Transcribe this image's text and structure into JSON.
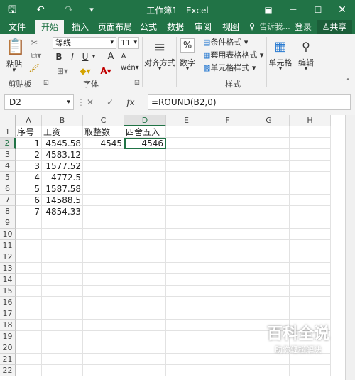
{
  "titlebar": {
    "title": "工作簿1 - Excel",
    "save_icon": "save-icon",
    "undo_icon": "undo-icon",
    "redo_icon": "redo-icon",
    "customize_icon": "customize-icon"
  },
  "tabs": [
    "文件",
    "开始",
    "插入",
    "页面布局",
    "公式",
    "数据",
    "审阅",
    "视图"
  ],
  "tell_me": "告诉我...",
  "login": "登录",
  "share": "共享",
  "ribbon": {
    "paste": "粘贴",
    "clipboard": "剪贴板",
    "font_name": "等线",
    "font_size": "11",
    "bold": "B",
    "italic": "I",
    "underline": "U",
    "font_group": "字体",
    "align": "对齐方式",
    "number": "数字",
    "percent": "%",
    "conditional": "条件格式",
    "table_format": "套用表格格式",
    "cell_style": "单元格样式",
    "style_group": "样式",
    "cells": "单元格",
    "edit": "编辑",
    "wen": "wén",
    "grow_font": "A",
    "shrink_font": "A"
  },
  "formula_bar": {
    "name_box": "D2",
    "cancel": "✕",
    "enter": "✓",
    "fx": "fx",
    "formula": "=ROUND(B2,0)"
  },
  "columns": [
    "A",
    "B",
    "C",
    "D",
    "E",
    "F",
    "G",
    "H"
  ],
  "rows": [
    "1",
    "2",
    "3",
    "4",
    "5",
    "6",
    "7",
    "8",
    "9",
    "10",
    "11",
    "12",
    "13",
    "14",
    "15",
    "16",
    "17",
    "18",
    "19",
    "20",
    "21",
    "22"
  ],
  "cells": {
    "A1": "序号",
    "B1": "工资",
    "C1": "取整数",
    "D1": "四舍五入",
    "A2": "1",
    "B2": "4545.58",
    "C2": "4545",
    "D2": "4546",
    "A3": "2",
    "B3": "4583.12",
    "A4": "3",
    "B4": "1577.52",
    "A5": "4",
    "B5": "4772.5",
    "A6": "5",
    "B6": "1587.58",
    "A7": "6",
    "B7": "14588.5",
    "A8": "7",
    "B8": "4854.33"
  },
  "watermark": {
    "title": "百科全说",
    "subtitle": "助你轻松解决"
  }
}
